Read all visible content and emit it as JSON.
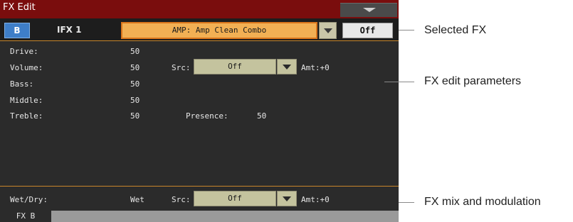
{
  "window": {
    "title": "FX Edit"
  },
  "header": {
    "slot_button": "B",
    "ifx_label": "IFX 1",
    "fx_selected": "AMP: Amp Clean Combo",
    "off_button": "Off"
  },
  "params": [
    {
      "name": "Drive:",
      "value": "50"
    },
    {
      "name": "Volume:",
      "value": "50"
    },
    {
      "name": "Bass:",
      "value": "50"
    },
    {
      "name": "Middle:",
      "value": "50"
    },
    {
      "name": "Treble:",
      "value": "50"
    }
  ],
  "volume_mod": {
    "src_label": "Src:",
    "src_value": "Off",
    "amt": "Amt:+0"
  },
  "presence": {
    "label": "Presence:",
    "value": "50"
  },
  "mix": {
    "label": "Wet/Dry:",
    "value": "Wet",
    "src_label": "Src:",
    "src_value": "Off",
    "amt": "Amt:+0"
  },
  "tabs": [
    {
      "label": "FX B"
    }
  ],
  "callouts": [
    {
      "text": "Selected FX"
    },
    {
      "text": "FX edit parameters"
    },
    {
      "text": "FX mix and modulation"
    }
  ],
  "colors": {
    "title_bar": "#7a0d0d",
    "accent_orange": "#f2b054",
    "slot_blue": "#3e7ec8",
    "panel_bg": "#2b2b2b",
    "src_box": "#c4c39e"
  },
  "icons": {
    "menu": "chevron-down-icon",
    "dropdown": "dropdown-arrow-icon"
  }
}
